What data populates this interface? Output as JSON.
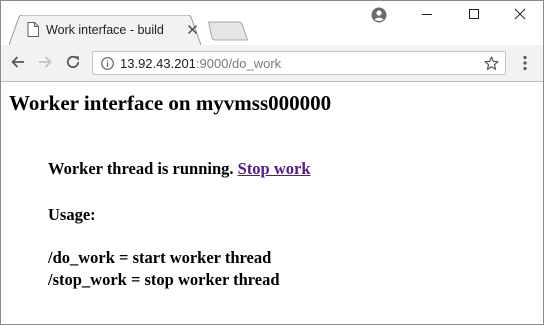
{
  "browser": {
    "tab_title": "Work interface - build",
    "url_host": "13.92.43.201",
    "url_rest": ":9000/do_work"
  },
  "page": {
    "title": "Worker interface on myvmss000000",
    "status_text": "Worker thread is running.",
    "stop_link": "Stop work",
    "usage_label": "Usage:",
    "usage_lines": [
      "/do_work = start worker thread",
      "/stop_work = stop worker thread"
    ]
  },
  "icons": {
    "tab": "document-icon",
    "close": "close-icon",
    "profile": "profile-icon",
    "back": "back-arrow-icon",
    "forward": "forward-arrow-icon",
    "reload": "reload-icon",
    "info": "info-icon",
    "star": "star-icon",
    "menu": "kebab-menu-icon"
  },
  "colors": {
    "visited_link": "#551a8b",
    "toolbar_bg": "#f2f2f2"
  }
}
